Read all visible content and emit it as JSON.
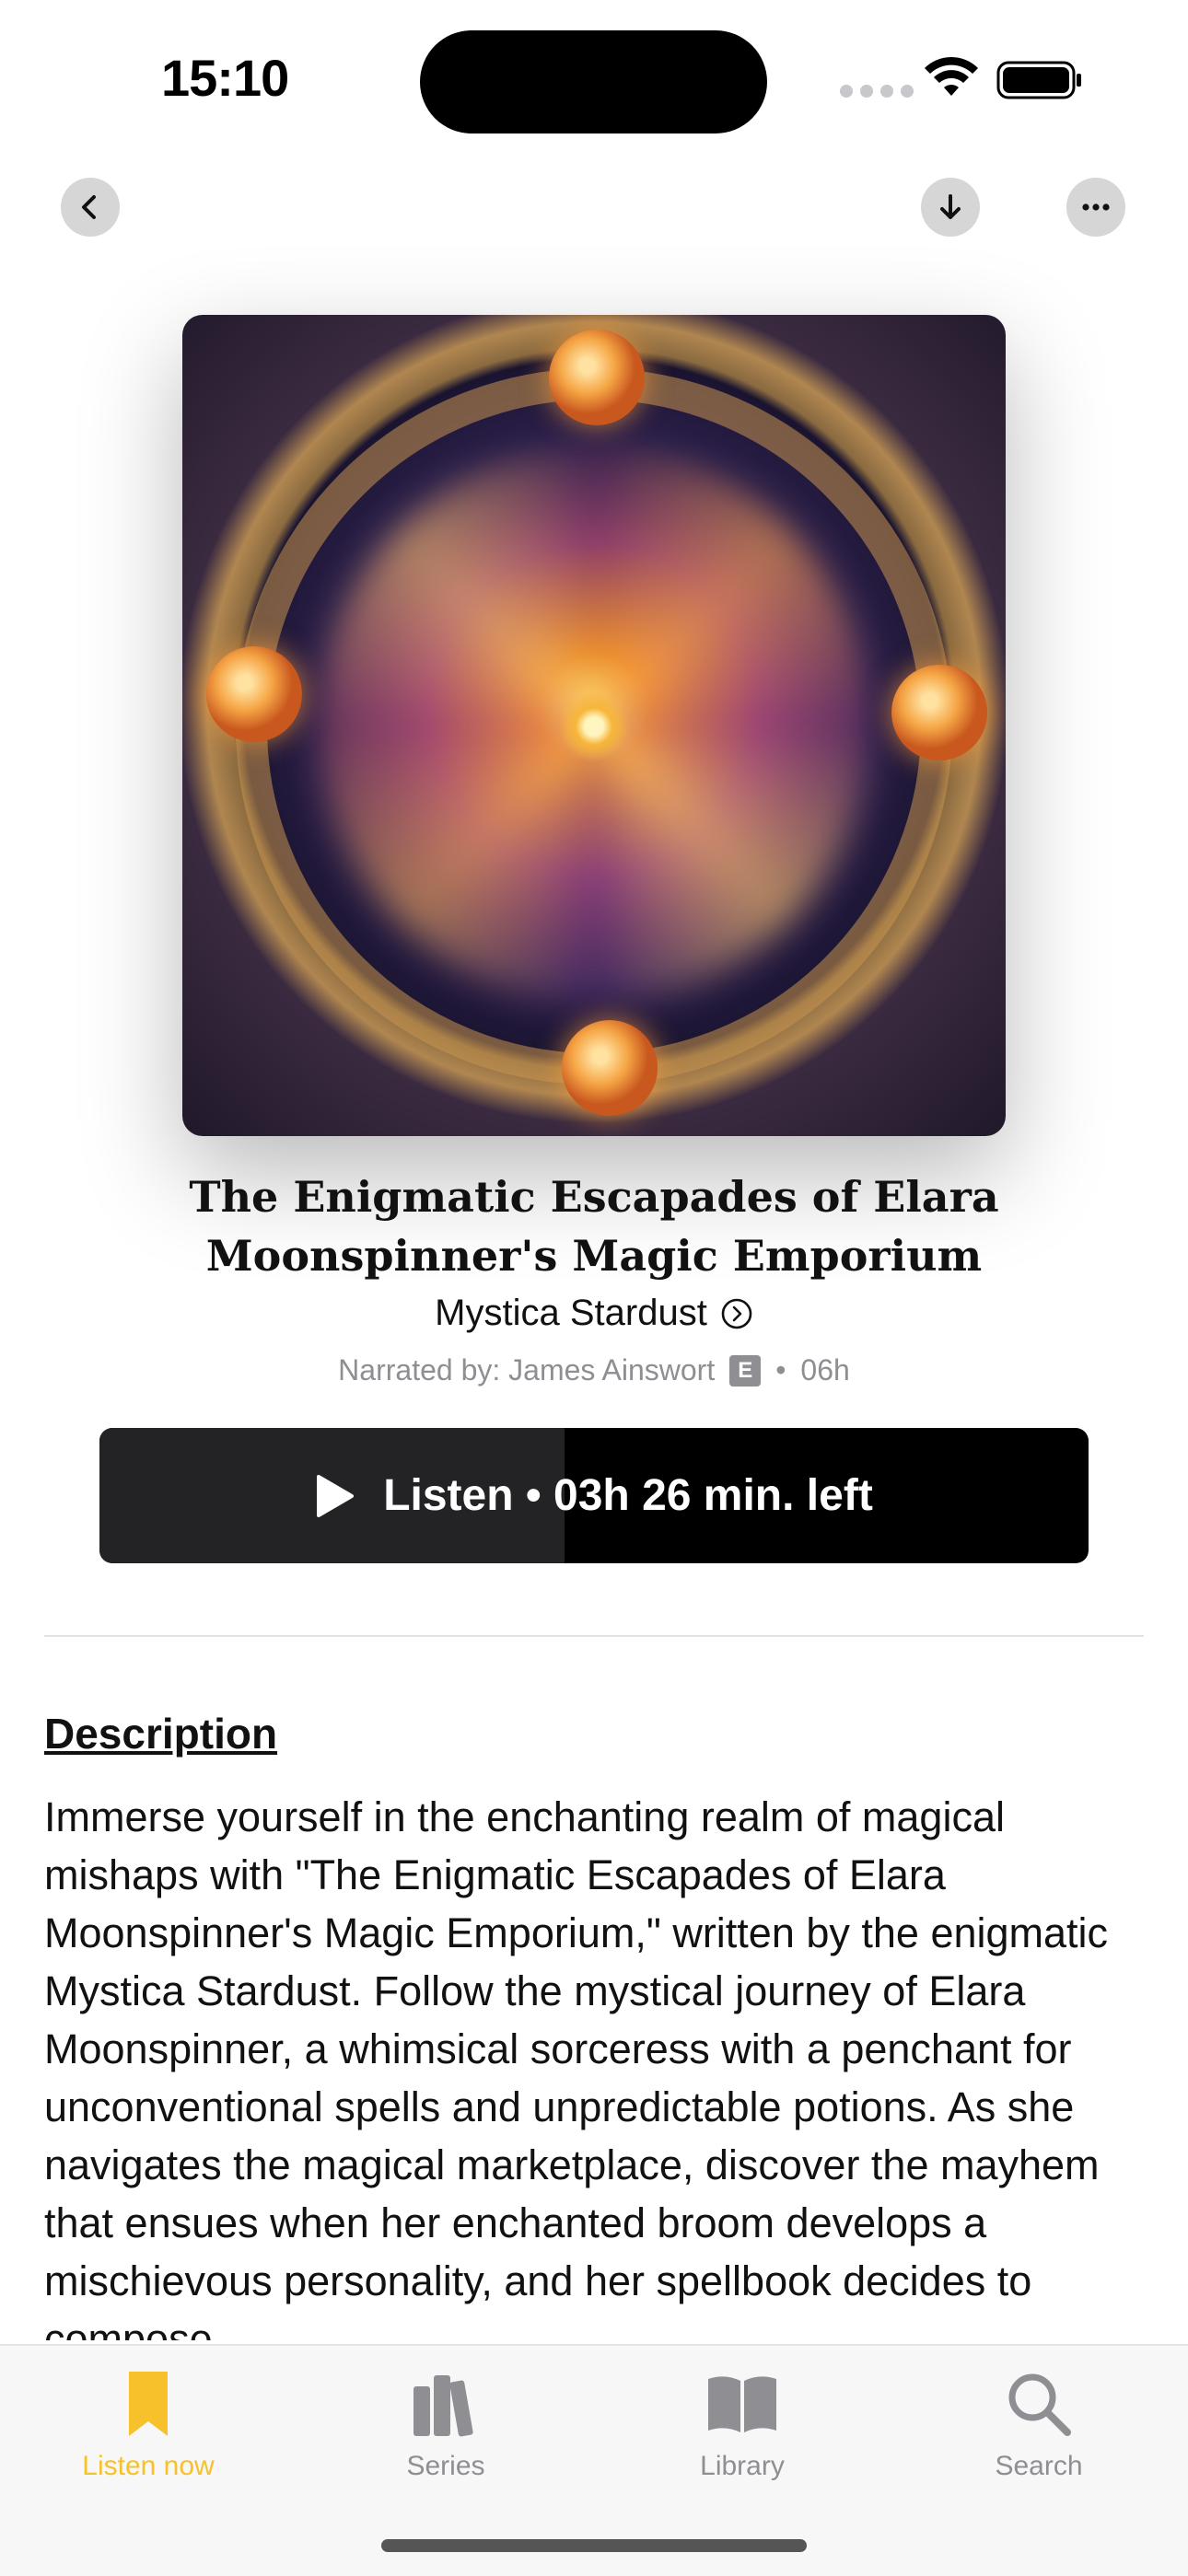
{
  "status_bar": {
    "time": "15:10"
  },
  "nav": {
    "back_icon": "chevron-left-icon",
    "download_icon": "arrow-down-icon",
    "more_icon": "ellipsis-icon"
  },
  "book": {
    "title": "The Enigmatic Escapades of Elara Moonspinner's Magic Emporium",
    "author": "Mystica Stardust",
    "narrated_by": "Narrated by: James Ainswort",
    "explicit_badge": "E",
    "separator": "•",
    "duration": "06h"
  },
  "listen_button": {
    "label": "Listen • 03h 26 min. left",
    "progress_fraction": 0.47
  },
  "description": {
    "heading": "Description",
    "text": "Immerse yourself in the enchanting realm of magical mishaps with \"The Enigmatic Escapades of Elara Moonspinner's Magic Emporium,\" written by the enigmatic Mystica Stardust. Follow the mystical journey of Elara Moonspinner, a whimsical sorceress with a penchant for unconventional spells and unpredictable potions. As she navigates the magical marketplace, discover the mayhem that ensues when her enchanted broom develops a mischievous personality, and her spellbook decides to compose"
  },
  "tab_bar": {
    "items": [
      {
        "label": "Listen now",
        "icon": "bookmark-icon",
        "active": true
      },
      {
        "label": "Series",
        "icon": "books-icon",
        "active": false
      },
      {
        "label": "Library",
        "icon": "open-book-icon",
        "active": false
      },
      {
        "label": "Search",
        "icon": "magnifier-icon",
        "active": false
      }
    ]
  },
  "colors": {
    "accent": "#f6c12a",
    "button_bg": "#000000",
    "button_progress": "#232326",
    "muted": "#8e8e93"
  }
}
